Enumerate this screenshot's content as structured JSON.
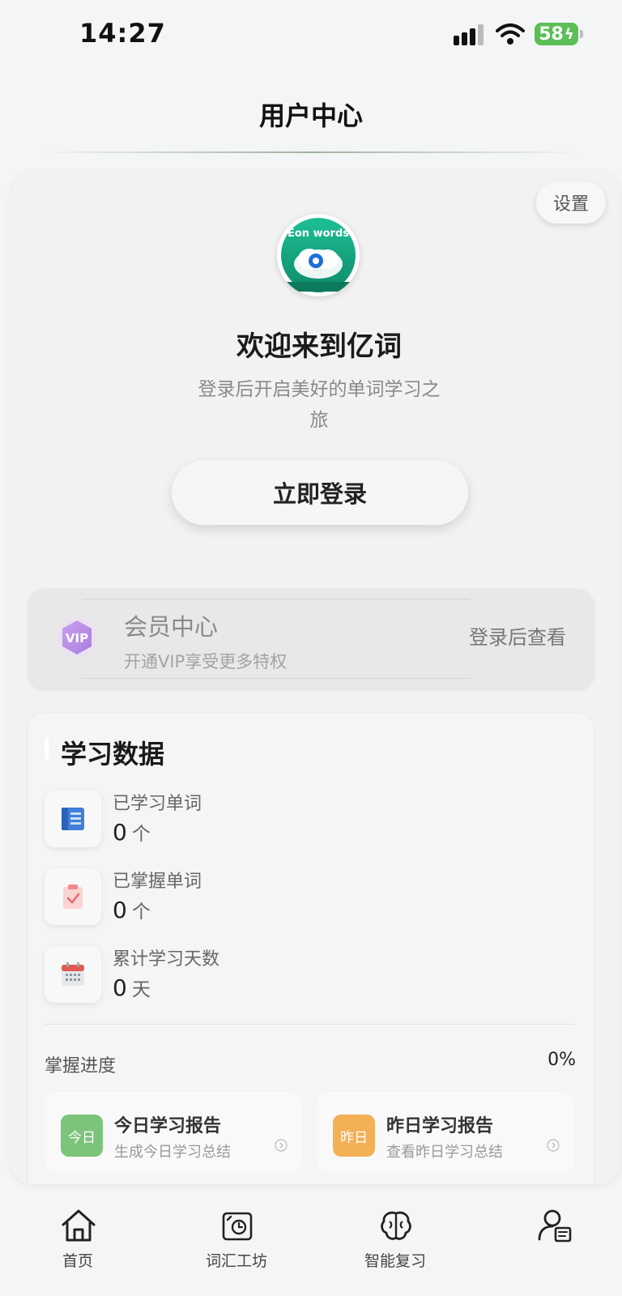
{
  "status_bar": {
    "time": "14:27",
    "battery": "58"
  },
  "header": {
    "title": "用户中心"
  },
  "profile": {
    "settings_label": "设置",
    "welcome_title": "欢迎来到亿词",
    "welcome_subtitle": "登录后开启美好的单词学习之旅",
    "login_label": "立即登录"
  },
  "vip": {
    "badge": "VIP",
    "title": "会员中心",
    "subtitle": "开通VIP享受更多特权",
    "action": "登录后查看"
  },
  "study": {
    "title": "学习数据",
    "stats": [
      {
        "label": "已学习单词",
        "value": "0",
        "unit": "个",
        "icon": "book-icon"
      },
      {
        "label": "已掌握单词",
        "value": "0",
        "unit": "个",
        "icon": "clipboard-check-icon"
      },
      {
        "label": "累计学习天数",
        "value": "0",
        "unit": "天",
        "icon": "calendar-icon"
      }
    ],
    "progress_label": "掌握进度",
    "progress_value": "0%",
    "reports": [
      {
        "badge": "今日",
        "title": "今日学习报告",
        "subtitle": "生成今日学习总结",
        "color": "#7cc47a"
      },
      {
        "badge": "昨日",
        "title": "昨日学习报告",
        "subtitle": "查看昨日学习总结",
        "color": "#f3b055"
      }
    ]
  },
  "nav": [
    {
      "label": "首页",
      "icon": "home-icon"
    },
    {
      "label": "词汇工坊",
      "icon": "workshop-icon"
    },
    {
      "label": "智能复习",
      "icon": "brain-icon"
    },
    {
      "label": "",
      "icon": "user-icon"
    }
  ]
}
